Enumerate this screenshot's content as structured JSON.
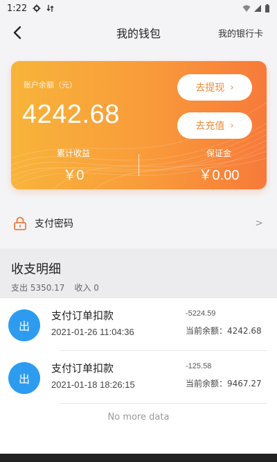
{
  "status_bar": {
    "time": "1:22"
  },
  "nav": {
    "title": "我的钱包",
    "right_link": "我的银行卡"
  },
  "card": {
    "balance_label": "账户余额（元）",
    "balance": "4242.68",
    "withdraw_label": "去提现",
    "recharge_label": "去充值",
    "income_label": "累计收益",
    "income_value": "￥0",
    "deposit_label": "保证金",
    "deposit_value": "￥0.00"
  },
  "pay_password": {
    "label": "支付密码",
    "arrow": ">"
  },
  "ledger": {
    "title": "收支明细",
    "expense": "支出 5350.17",
    "income": "收入 0"
  },
  "transactions": [
    {
      "type_glyph": "出",
      "title": "支付订单扣款",
      "time": "2021-01-26 11:04:36",
      "amount": "-5224.59",
      "balance": "当前余额：4242.68"
    },
    {
      "type_glyph": "出",
      "title": "支付订单扣款",
      "time": "2021-01-18 18:26:15",
      "amount": "-125.58",
      "balance": "当前余额：9467.27"
    }
  ],
  "footer": {
    "no_more": "No more data"
  },
  "colors": {
    "accent": "#f99a3a",
    "avatar": "#2d9cf0"
  },
  "icons": {
    "back": "chevron-left-icon",
    "lock": "lock-icon",
    "settings": "gear-icon",
    "wifi": "wifi-icon",
    "signal": "signal-icon",
    "battery": "battery-icon"
  }
}
